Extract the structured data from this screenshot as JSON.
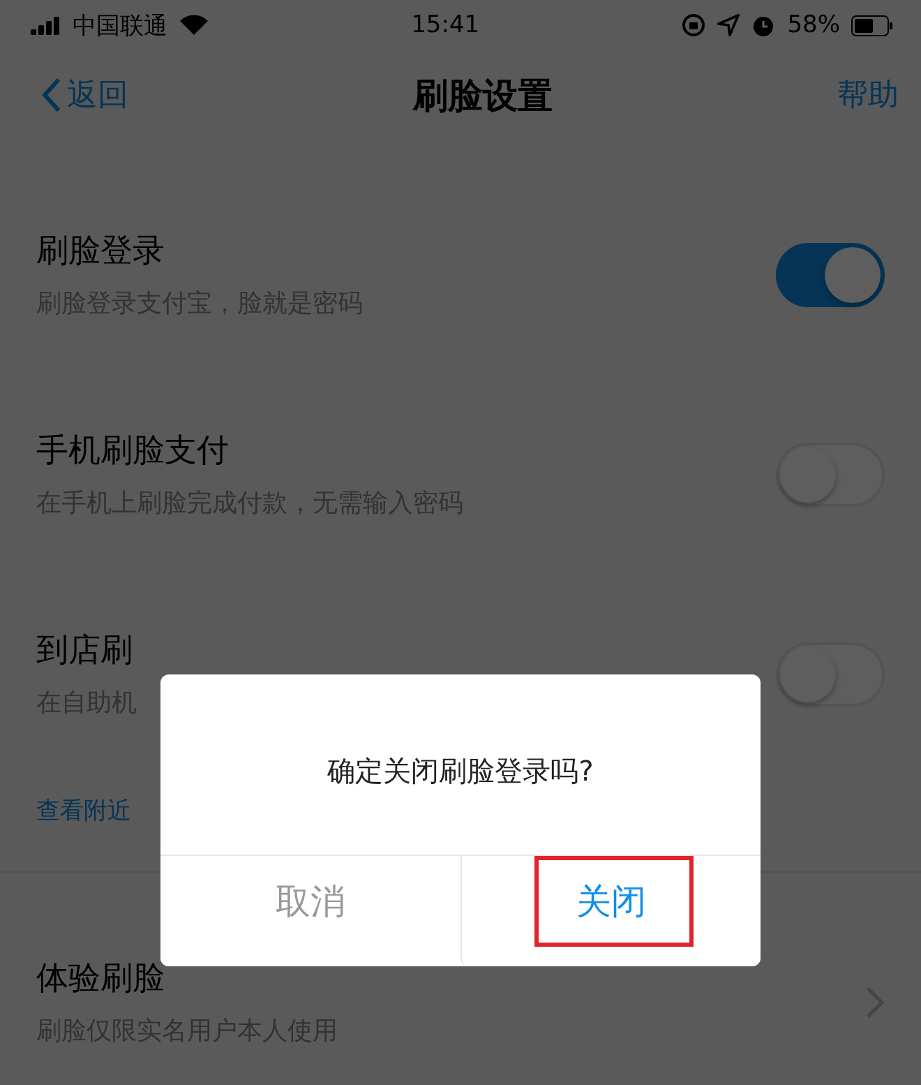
{
  "status_bar": {
    "carrier": "中国联通",
    "time": "15:41",
    "battery": "58%"
  },
  "nav": {
    "back": "返回",
    "title": "刷脸设置",
    "help": "帮助"
  },
  "settings": [
    {
      "kind": "toggle",
      "title": "刷脸登录",
      "subtitle": "刷脸登录支付宝，脸就是密码",
      "on": true
    },
    {
      "kind": "toggle",
      "title": "手机刷脸支付",
      "subtitle": "在手机上刷脸完成付款，无需输入密码",
      "on": false
    },
    {
      "kind": "toggle",
      "title": "到店刷",
      "subtitle": "在自助机",
      "on": false,
      "link": "查看附近"
    },
    {
      "kind": "link",
      "title": "体验刷脸",
      "subtitle": "刷脸仅限实名用户本人使用"
    }
  ],
  "dialog": {
    "message": "确定关闭刷脸登录吗?",
    "buttons": [
      {
        "label": "取消",
        "kind": "cancel",
        "highlighted": false
      },
      {
        "label": "关闭",
        "kind": "confirm",
        "highlighted": true
      }
    ]
  }
}
